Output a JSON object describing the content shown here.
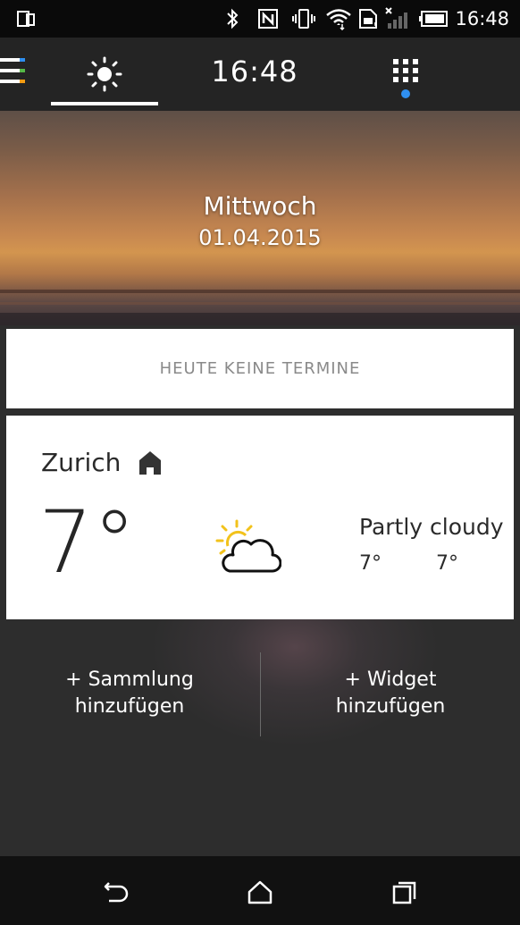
{
  "status_bar": {
    "time": "16:48",
    "icons": [
      "screenshot-icon",
      "bluetooth-icon",
      "nfc-icon",
      "vibrate-icon",
      "wifi-icon",
      "sim-icon",
      "signal-icon",
      "battery-icon"
    ]
  },
  "header": {
    "time": "16:48",
    "menu_colors": [
      "#2f8ff0",
      "#56b947",
      "#f39c12"
    ],
    "notification_dot_color": "#2f8ff0"
  },
  "hero": {
    "day": "Mittwoch",
    "date": "01.04.2015"
  },
  "events": {
    "text": "HEUTE KEINE TERMINE"
  },
  "weather": {
    "city": "Zurich",
    "temperature": "7°",
    "condition": "Partly cloudy",
    "high": "7°",
    "low": "7°",
    "icon": "partly-cloudy-icon"
  },
  "actions": {
    "add_collection": "+ Sammlung\nhinzufügen",
    "add_collection_line1": "+ Sammlung",
    "add_collection_line2": "hinzufügen",
    "add_widget_line1": "+ Widget",
    "add_widget_line2": "hinzufügen"
  },
  "nav": {
    "items": [
      "back-icon",
      "home-icon",
      "recents-icon"
    ]
  }
}
